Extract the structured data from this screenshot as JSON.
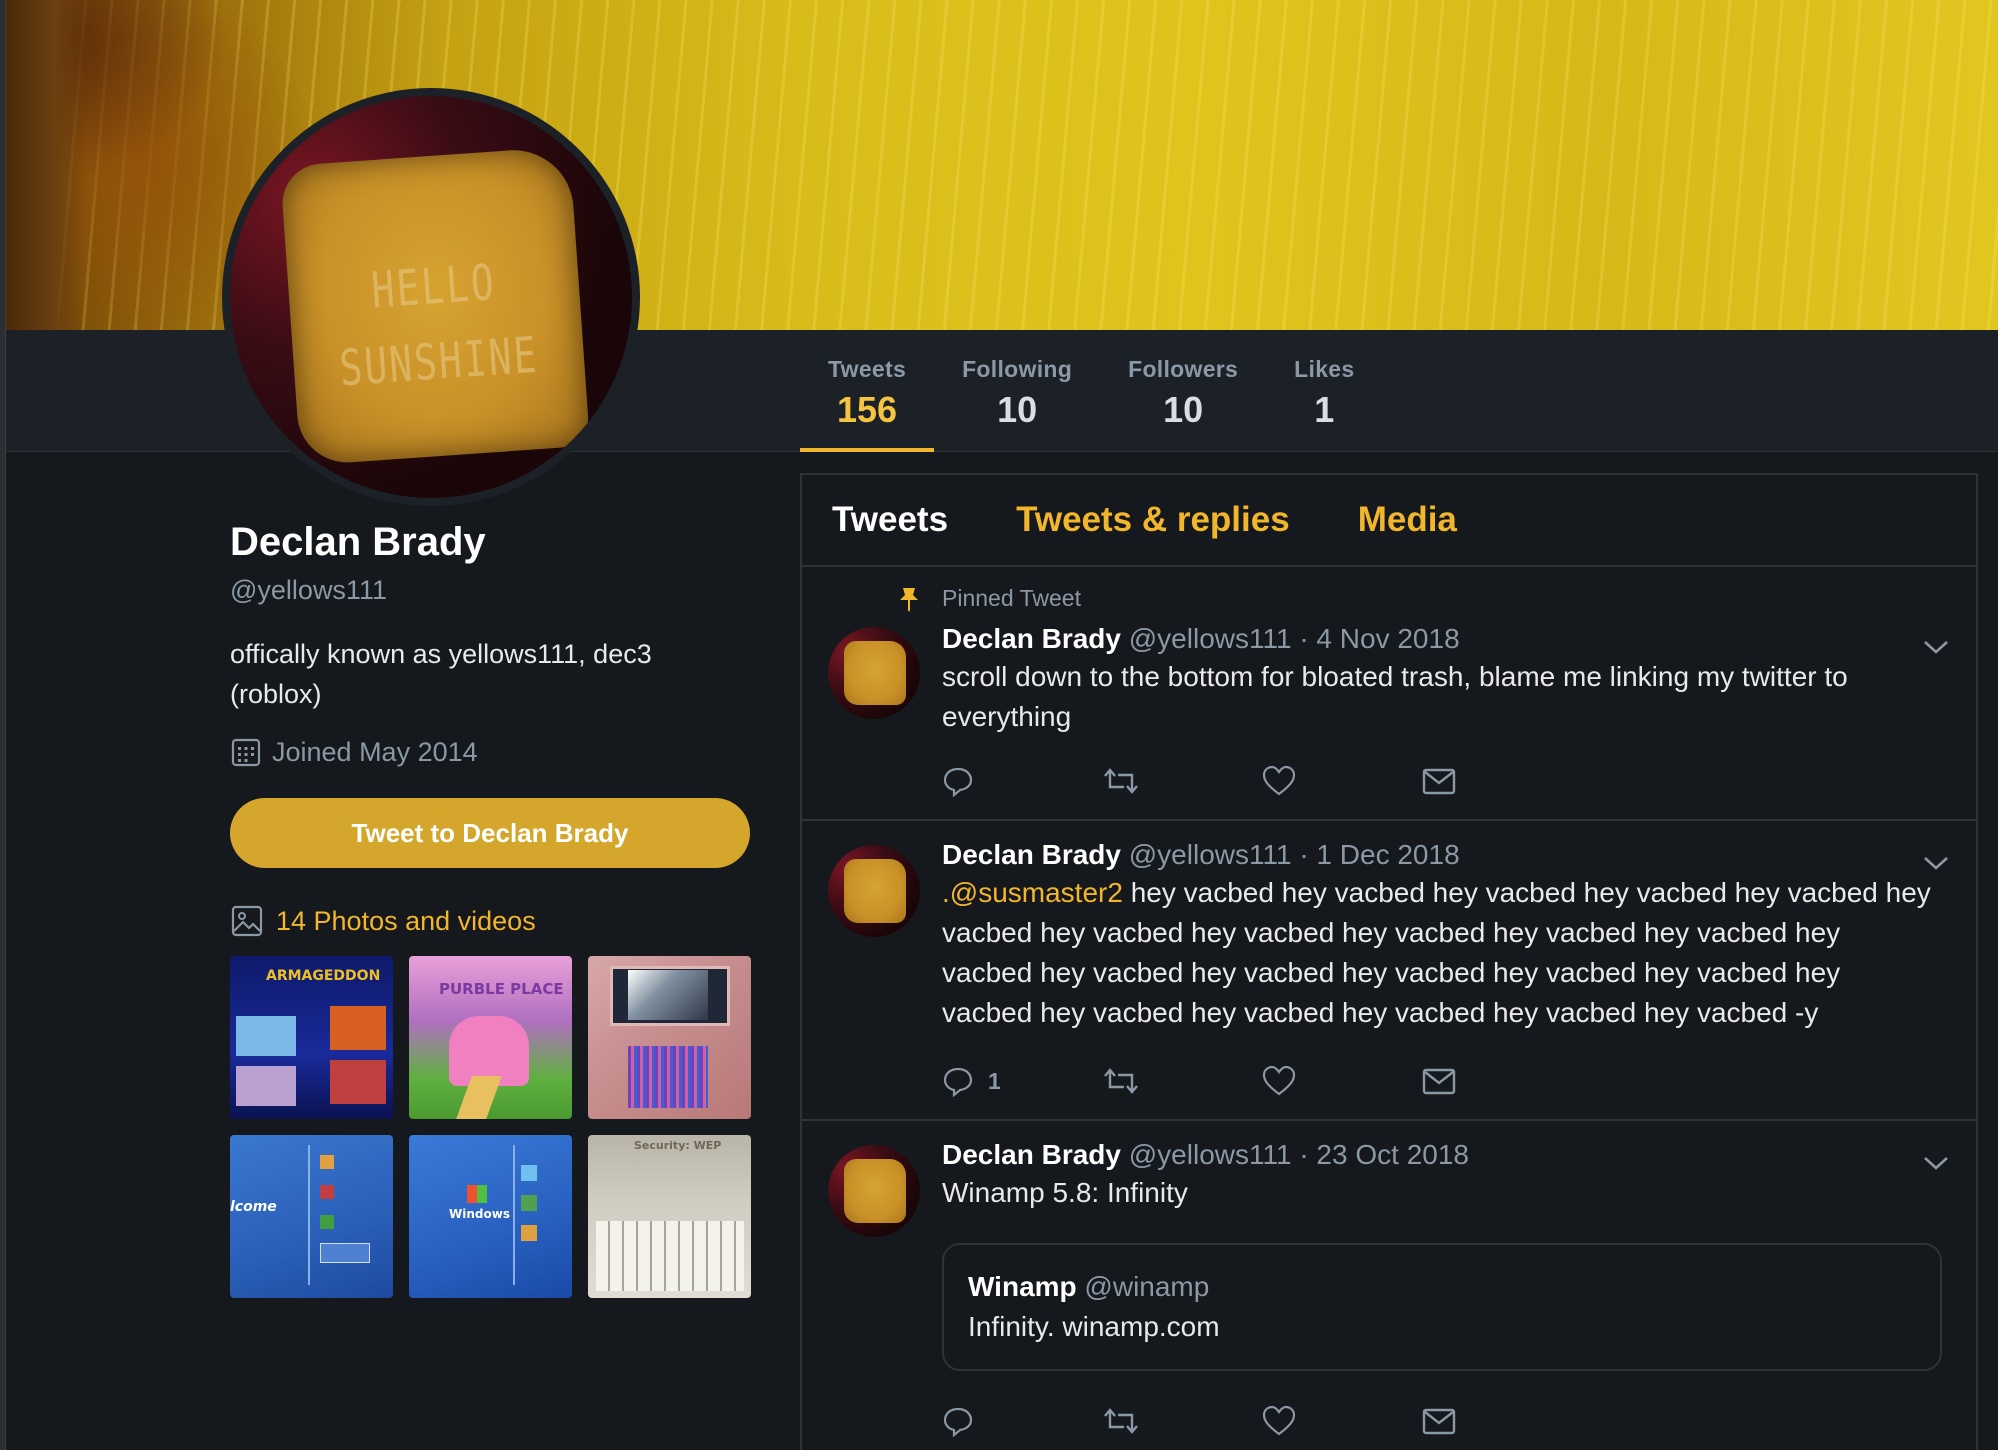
{
  "profile": {
    "name": "Declan Brady",
    "handle": "@yellows111",
    "bio": "offically known as yellows111, dec3 (roblox)",
    "joined": "Joined May 2014",
    "tweet_to_button": "Tweet to Declan Brady",
    "photos_link": "14 Photos and videos",
    "thumbnails": [
      {
        "caption": "ARMAGEDDON"
      },
      {
        "caption": "PURBLE PLACE"
      },
      {
        "caption": ""
      },
      {
        "caption": "lcome"
      },
      {
        "caption": "Windows"
      },
      {
        "caption": "Security: WEP"
      }
    ]
  },
  "stats": [
    {
      "label": "Tweets",
      "value": "156",
      "active": true
    },
    {
      "label": "Following",
      "value": "10",
      "active": false
    },
    {
      "label": "Followers",
      "value": "10",
      "active": false
    },
    {
      "label": "Likes",
      "value": "1",
      "active": false
    }
  ],
  "timeline_tabs": [
    {
      "label": "Tweets",
      "active": true
    },
    {
      "label": "Tweets & replies",
      "active": false
    },
    {
      "label": "Media",
      "active": false
    }
  ],
  "tweets": [
    {
      "pinned_label": "Pinned Tweet",
      "name": "Declan Brady",
      "handle": "@yellows111",
      "date": "· 4 Nov 2018",
      "text": "scroll down to the bottom for bloated trash, blame me linking my twitter to everything",
      "reply_count": ""
    },
    {
      "name": "Declan Brady",
      "handle": "@yellows111",
      "date": "· 1 Dec 2018",
      "mention": ".@susmaster2",
      "text": " hey vacbed hey vacbed hey vacbed hey vacbed hey vacbed hey vacbed hey vacbed hey vacbed hey vacbed hey vacbed hey vacbed hey vacbed hey vacbed hey vacbed hey vacbed hey vacbed hey vacbed hey vacbed hey vacbed hey vacbed hey vacbed hey vacbed hey vacbed -y",
      "reply_count": "1"
    },
    {
      "name": "Declan Brady",
      "handle": "@yellows111",
      "date": "· 23 Oct 2018",
      "text": "Winamp 5.8: Infinity",
      "reply_count": "",
      "card": {
        "name": "Winamp",
        "handle": "@winamp",
        "text": "Infinity. winamp.com"
      }
    }
  ],
  "banner_text": "HELLO SUNSHINE",
  "colors": {
    "accent": "#f2b62c",
    "button": "#d4a72c",
    "background": "#15181c",
    "navbar": "#1c2128",
    "muted": "#8b98a5"
  }
}
